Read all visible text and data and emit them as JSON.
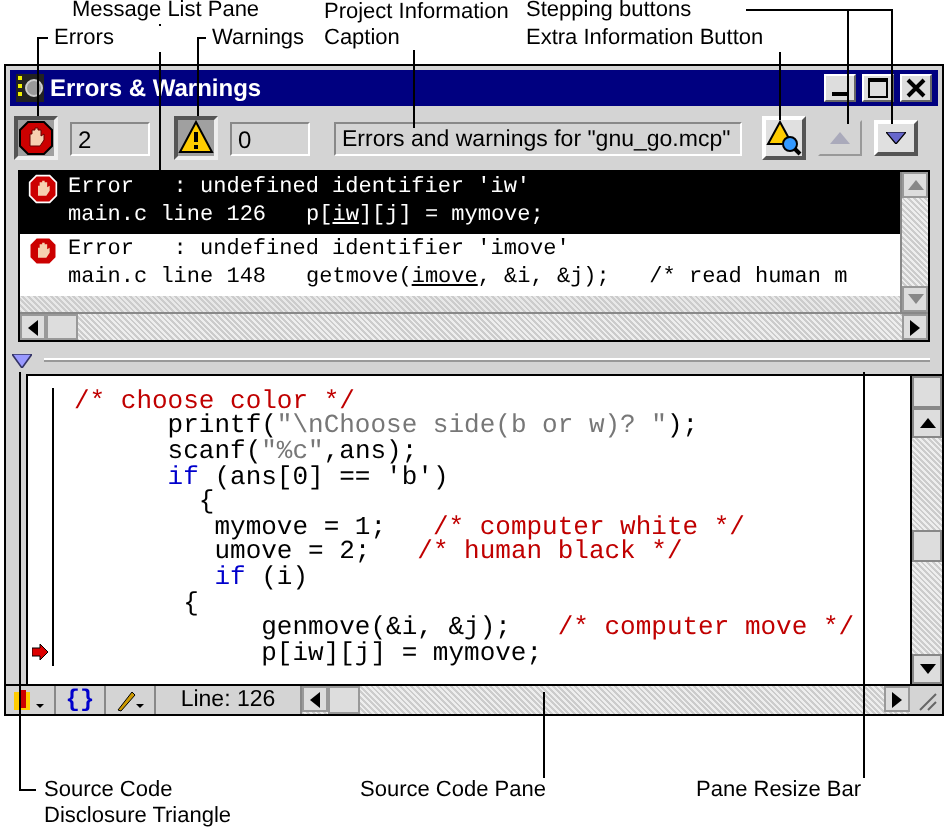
{
  "callouts": [
    {
      "text": "Message List Pane"
    },
    {
      "text": "Errors"
    },
    {
      "text": "Warnings"
    },
    {
      "text": "Project Information Caption"
    },
    {
      "text": "Stepping buttons"
    },
    {
      "text": "Extra Information Button"
    },
    {
      "text": "Source Code Disclosure Triangle"
    },
    {
      "text": "Source Code Pane"
    },
    {
      "text": "Pane Resize Bar"
    }
  ],
  "window": {
    "title": "Errors & Warnings"
  },
  "toolbar": {
    "errors_count": "2",
    "warnings_count": "0",
    "caption": "Errors and warnings for \"gnu_go.mcp\""
  },
  "stepping_buttons": [
    {
      "kind": "up",
      "disabled": true
    },
    {
      "kind": "down",
      "disabled": false
    }
  ],
  "messages": [
    {
      "kind": "error",
      "selected": true,
      "text": "Error   : undefined identifier 'iw'",
      "location": "main.c line 126",
      "code_before": "p[",
      "code_error": "iw",
      "code_after": "][j] = mymove;"
    },
    {
      "kind": "error",
      "selected": false,
      "text": "Error   : undefined identifier 'imove'",
      "location": "main.c line 148",
      "code_before": "getmove(",
      "code_error": "imove",
      "code_after": ", &i, &j);   /* read human m"
    }
  ],
  "source_lines": [
    {
      "current": false,
      "segments": [
        {
          "kind": "comment",
          "text": "/* choose color */"
        }
      ]
    },
    {
      "current": false,
      "segments": [
        {
          "kind": "plain",
          "text": "      printf("
        },
        {
          "kind": "string",
          "text": "\"\\nChoose side(b or w)? \""
        },
        {
          "kind": "plain",
          "text": ");"
        }
      ]
    },
    {
      "current": false,
      "segments": [
        {
          "kind": "plain",
          "text": "      scanf("
        },
        {
          "kind": "string",
          "text": "\"%c\""
        },
        {
          "kind": "plain",
          "text": ",ans);"
        }
      ]
    },
    {
      "current": false,
      "segments": [
        {
          "kind": "keyword",
          "text": "      if"
        },
        {
          "kind": "plain",
          "text": " (ans[0] == 'b')"
        }
      ]
    },
    {
      "current": false,
      "segments": [
        {
          "kind": "plain",
          "text": "        {"
        }
      ]
    },
    {
      "current": false,
      "segments": [
        {
          "kind": "plain",
          "text": "         mymove = 1;   "
        },
        {
          "kind": "comment",
          "text": "/* computer white */"
        }
      ]
    },
    {
      "current": false,
      "segments": [
        {
          "kind": "plain",
          "text": "         umove = 2;   "
        },
        {
          "kind": "comment",
          "text": "/* human black */"
        }
      ]
    },
    {
      "current": false,
      "segments": [
        {
          "kind": "keyword",
          "text": "         if"
        },
        {
          "kind": "plain",
          "text": " (i)"
        }
      ]
    },
    {
      "current": false,
      "segments": [
        {
          "kind": "plain",
          "text": "       {"
        }
      ]
    },
    {
      "current": false,
      "segments": [
        {
          "kind": "plain",
          "text": "            genmove(&i, &j);   "
        },
        {
          "kind": "comment",
          "text": "/* computer move */"
        }
      ]
    },
    {
      "current": true,
      "segments": [
        {
          "kind": "plain",
          "text": "            p[iw][j] = mymove;"
        }
      ]
    }
  ],
  "status_bar": {
    "functions_menu": "{}",
    "line_indicator": "Line: 126"
  }
}
